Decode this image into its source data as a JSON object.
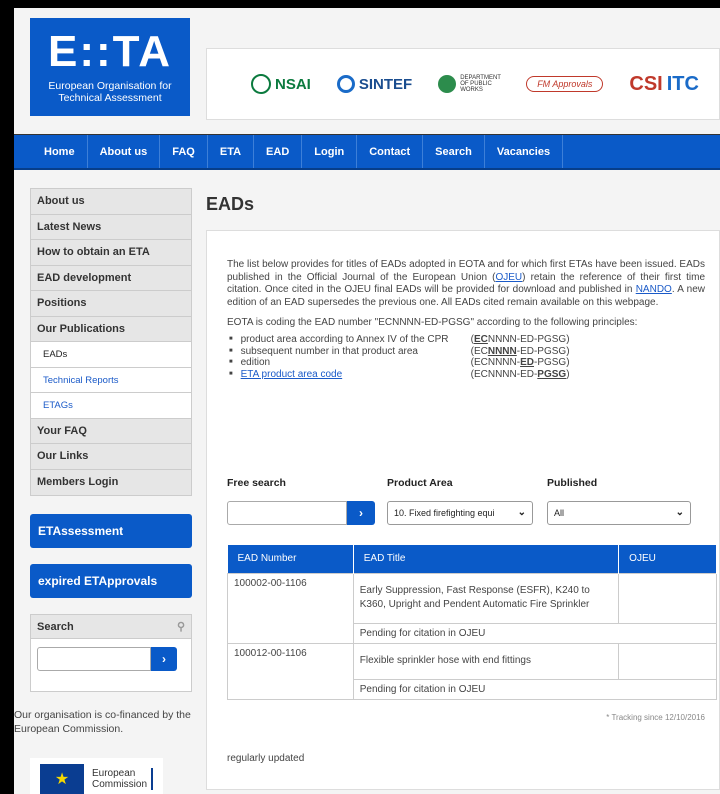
{
  "header": {
    "logo_main": "E::TA",
    "logo_sub": "European Organisation for Technical Assessment",
    "partners": {
      "nsai": "NSAI",
      "sintef": "SINTEF",
      "dept": "DEPARTMENT OF PUBLIC WORKS",
      "fm": "FM Approvals",
      "itc_a": "CSI",
      "itc_b": "ITC"
    }
  },
  "nav": [
    "Home",
    "About us",
    "FAQ",
    "ETA",
    "EAD",
    "Login",
    "Contact",
    "Search",
    "Vacancies"
  ],
  "sidebar": {
    "items": [
      {
        "label": "About us"
      },
      {
        "label": "Latest News"
      },
      {
        "label": "How to obtain an ETA"
      },
      {
        "label": "EAD development"
      },
      {
        "label": "Positions"
      },
      {
        "label": "Our Publications"
      },
      {
        "label": "EADs"
      },
      {
        "label": "Technical Reports"
      },
      {
        "label": "ETAGs"
      },
      {
        "label": "Your FAQ"
      },
      {
        "label": "Our Links"
      },
      {
        "label": "Members Login"
      }
    ],
    "btn_etassessment": "ETAssessment",
    "btn_expired": "expired ETApprovals",
    "search_title": "Search",
    "go": "›",
    "cofinanced": "Our organisation is co-financed by the European Commission.",
    "ec_line1": "European",
    "ec_line2": "Commission"
  },
  "main": {
    "title": "EADs",
    "intro_1": "The list below provides for titles of EADs adopted in EOTA and for which first ETAs have been issued. EADs published in the Official Journal of the European Union (",
    "intro_link1": "OJEU",
    "intro_2": ") retain the reference of their first time citation. Once cited in the OJEU final EADs will be provided for download and published in ",
    "intro_link2": "NANDO",
    "intro_3": ". A new edition of an EAD supersedes the previous one. All EADs cited remain available on this webpage.",
    "coding_text": "EOTA is coding the EAD number \"ECNNNN-ED-PGSG\" according to the following principles:",
    "principles": [
      {
        "label": "product area according to Annex IV of the CPR",
        "pre": "(",
        "bold": "EC",
        "post": "NNNN-ED-PGSG)"
      },
      {
        "label": "subsequent number in that product area",
        "pre": "(EC",
        "bold": "NNNN",
        "post": "-ED-PGSG)"
      },
      {
        "label": "edition",
        "pre": "(ECNNNN-",
        "bold": "ED",
        "post": "-PGSG)"
      },
      {
        "label": "ETA product area code",
        "pre": "(ECNNNN-ED-",
        "bold": "PGSG",
        "post": ")"
      }
    ],
    "filters": {
      "free_search": "Free search",
      "product_area": "Product Area",
      "published": "Published",
      "product_area_value": "10. Fixed firefighting equi",
      "published_value": "All"
    },
    "table": {
      "headers": [
        "EAD Number",
        "EAD Title",
        "OJEU"
      ],
      "rows": [
        {
          "number": "100002-00-1106",
          "title": "Early Suppression, Fast Response (ESFR), K240 to K360, Upright and Pendent Automatic Fire Sprinkler",
          "status": "Pending for citation in OJEU"
        },
        {
          "number": "100012-00-1106",
          "title": "Flexible sprinkler hose with end fittings",
          "status": "Pending for citation in OJEU"
        }
      ]
    },
    "tracking": "* Tracking since 12/10/2016",
    "updated": "regularly updated"
  }
}
